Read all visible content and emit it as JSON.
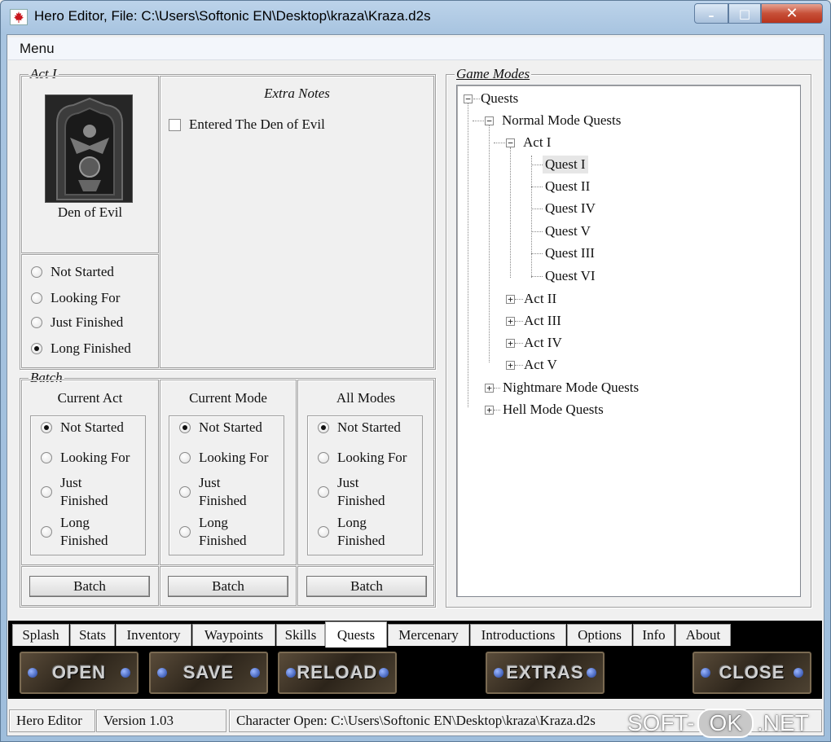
{
  "window": {
    "title": "Hero Editor, File: C:\\Users\\Softonic EN\\Desktop\\kraza\\Kraza.d2s",
    "icon": "maple-leaf-icon",
    "minimize": "–",
    "maximize": "□",
    "close": "✕"
  },
  "menu": {
    "label": "Menu"
  },
  "act": {
    "legend": "Act I",
    "quest_name": "Den of Evil",
    "extra_notes_title": "Extra Notes",
    "extra_note": "Entered The Den of Evil",
    "extra_note_checked": false,
    "status_options": [
      "Not Started",
      "Looking For",
      "Just Finished",
      "Long Finished"
    ],
    "selected_status": "Long Finished"
  },
  "batch": {
    "legend": "Batch",
    "columns": [
      {
        "title": "Current Act",
        "options": [
          "Not Started",
          "Looking For",
          "Just",
          "Finished",
          "Long",
          "Finished"
        ],
        "selected": "Not Started",
        "button": "Batch"
      },
      {
        "title": "Current Mode",
        "options": [
          "Not Started",
          "Looking For",
          "Just",
          "Finished",
          "Long",
          "Finished"
        ],
        "selected": "Not Started",
        "button": "Batch"
      },
      {
        "title": "All Modes",
        "options": [
          "Not Started",
          "Looking For",
          "Just",
          "Finished",
          "Long",
          "Finished"
        ],
        "selected": "Not Started",
        "button": "Batch"
      }
    ]
  },
  "game_modes": {
    "legend": "Game Modes",
    "tree": {
      "root": "Quests",
      "normal": "Normal Mode Quests",
      "act1": "Act I",
      "quests": [
        "Quest I",
        "Quest II",
        "Quest IV",
        "Quest V",
        "Quest III",
        "Quest VI"
      ],
      "selected_quest": "Quest I",
      "acts": [
        "Act II",
        "Act III",
        "Act IV",
        "Act V"
      ],
      "nightmare": "Nightmare Mode Quests",
      "hell": "Hell Mode Quests"
    }
  },
  "tabs": [
    "Splash",
    "Stats",
    "Inventory",
    "Waypoints",
    "Skills",
    "Quests",
    "Mercenary",
    "Introductions",
    "Options",
    "Info",
    "About"
  ],
  "active_tab": "Quests",
  "actions": {
    "open": "OPEN",
    "save": "SAVE",
    "reload": "RELOAD",
    "extras": "EXTRAS",
    "close": "CLOSE"
  },
  "status": {
    "app": "Hero Editor",
    "version": "Version 1.03",
    "file": "Character Open: C:\\Users\\Softonic EN\\Desktop\\kraza\\Kraza.d2s"
  },
  "watermark": {
    "part1": "SOFT-",
    "part2": "OK",
    "part3": ".NET"
  }
}
